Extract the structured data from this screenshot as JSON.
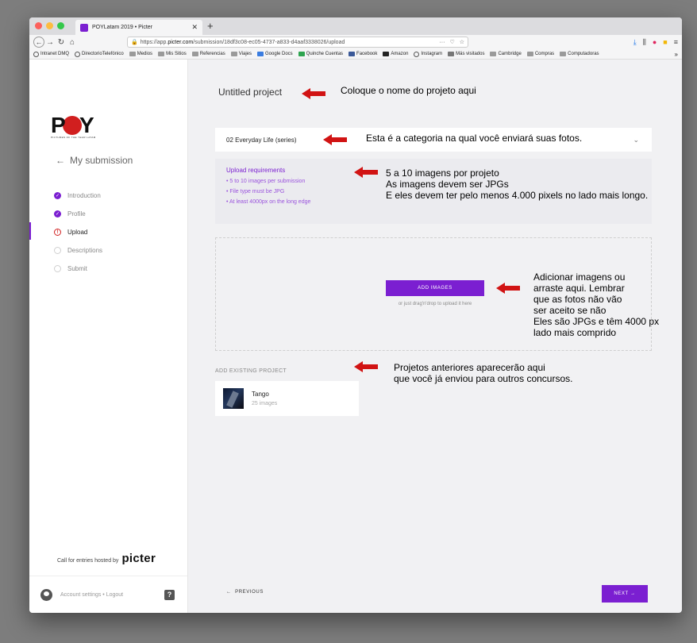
{
  "browser": {
    "tab_title": "POYLatam 2019 • Picter",
    "tab_close": "✕",
    "new_tab": "+",
    "url_domain_prefix": "https://app.",
    "url_domain": "picter.com",
    "url_path": "/submission/18df3c08-ec05-4737-a833-d4aaf3338026/upload",
    "url_dots": "···",
    "bookmarks": [
      "Intranet DMQ",
      "DirectorioTelefónico",
      "Medios",
      "Mis Sitios",
      "Referencias",
      "Viajes",
      "Google Docs",
      "Quinche Cuentas",
      "Facebook",
      "Amazon",
      "Instagram",
      "Más visitados",
      "Cambridge",
      "Compras",
      "Computadoras"
    ],
    "bookmarks_more": "»"
  },
  "sidebar": {
    "logo_letters": [
      "P",
      "Y"
    ],
    "logo_tagline": "PICTURES OF THE YEAR LATAM",
    "back_label": "My submission",
    "steps": [
      {
        "label": "Introduction",
        "state": "done"
      },
      {
        "label": "Profile",
        "state": "done"
      },
      {
        "label": "Upload",
        "state": "current"
      },
      {
        "label": "Descriptions",
        "state": "todo"
      },
      {
        "label": "Submit",
        "state": "todo"
      }
    ],
    "hosted_text": "Call for entries hosted by",
    "hosted_brand": "picter",
    "account_text": "Account settings • Logout",
    "help_label": "?"
  },
  "main": {
    "project_title": "Untitled project",
    "category": "02 Everyday Life (series)",
    "requirements_title": "Upload requirements",
    "requirements": [
      "5 to 10 images per submission",
      "File type must be JPG",
      "At least 4000px on the long edge"
    ],
    "add_images": "ADD IMAGES",
    "drag_hint": "or just drag'n'drop to upload it here",
    "existing_label": "ADD EXISTING PROJECT",
    "existing_project": {
      "title": "Tango",
      "count": "25 images"
    },
    "previous": "PREVIOUS",
    "next": "NEXT"
  },
  "annotations": {
    "title": "Coloque o nome do projeto aqui",
    "category": "Esta é a categoria na qual você enviará suas fotos.",
    "requirements": [
      "5 a 10 imagens por projeto",
      "As imagens devem ser JPGs",
      "E eles devem ter pelo menos 4.000 pixels no lado mais longo."
    ],
    "add_images": [
      "Adicionar imagens ou",
      "arraste aqui. Lembrar",
      "que as fotos não vão",
      "ser aceito se não",
      "Eles são JPGs e têm 4000 px",
      "lado mais comprido"
    ],
    "existing": [
      "Projetos anteriores aparecerão aqui",
      "que você já enviou para outros concursos."
    ]
  },
  "colors": {
    "accent": "#7b1fd1",
    "arrow": "#d11313",
    "logo_red": "#d11f1f"
  },
  "icons": {
    "back": "arrow-left-icon",
    "check": "check-icon",
    "error": "alert-icon",
    "chevron": "chevron-down-icon",
    "next": "arrow-right-icon"
  }
}
